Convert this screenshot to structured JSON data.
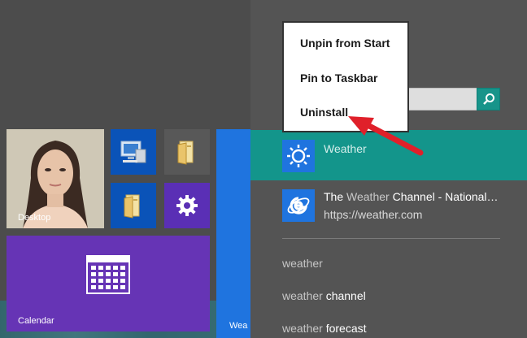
{
  "start_screen": {
    "tiles": {
      "desktop": {
        "label": "Desktop"
      },
      "calendar": {
        "label": "Calendar"
      },
      "weather": {
        "label": "Wea"
      }
    }
  },
  "search_pane": {
    "query_value": "",
    "results": [
      {
        "title_hl": "",
        "title_main": "Weather",
        "icon": "sun-icon",
        "selected": true
      },
      {
        "title_prefix": "The ",
        "title_hl": "Weather",
        "title_rest": " Channel - National…",
        "url": "https://weather.com",
        "icon": "internet-explorer-icon"
      }
    ],
    "suggestions": [
      {
        "match": "weather",
        "rest": ""
      },
      {
        "match": "weather",
        "rest": " channel"
      },
      {
        "match": "weather",
        "rest": " forecast"
      }
    ]
  },
  "context_menu": {
    "items": [
      "Unpin from Start",
      "Pin to Taskbar",
      "Uninstall"
    ]
  },
  "colors": {
    "selected_result": "#13958b",
    "search_button": "#17948a",
    "tile_blue": "#1f74df",
    "tile_purple": "#6634b5",
    "annotation_arrow": "#e0202a"
  }
}
